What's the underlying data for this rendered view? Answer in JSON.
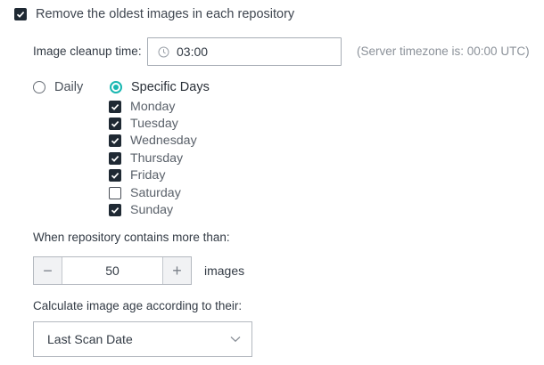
{
  "remove_oldest": {
    "label": "Remove the oldest images in each repository",
    "checked": true
  },
  "cleanup_time": {
    "label": "Image cleanup time:",
    "value": "03:00",
    "timezone_note": "(Server timezone is: 00:00 UTC)"
  },
  "schedule": {
    "options": [
      {
        "label": "Daily",
        "selected": false
      },
      {
        "label": "Specific Days",
        "selected": true
      }
    ],
    "days": [
      {
        "label": "Monday",
        "checked": true
      },
      {
        "label": "Tuesday",
        "checked": true
      },
      {
        "label": "Wednesday",
        "checked": true
      },
      {
        "label": "Thursday",
        "checked": true
      },
      {
        "label": "Friday",
        "checked": true
      },
      {
        "label": "Saturday",
        "checked": false
      },
      {
        "label": "Sunday",
        "checked": true
      }
    ]
  },
  "repo_count": {
    "label": "When repository contains more than:",
    "decrement": "−",
    "value": "50",
    "increment": "+",
    "suffix": "images"
  },
  "age": {
    "label": "Calculate image age according to their:",
    "selected": "Last Scan Date"
  },
  "icons": {
    "checkbox_check": "check-icon",
    "time": "clock-icon",
    "dropdown": "chevron-down-icon"
  },
  "colors": {
    "checkbox_fill": "#1f2933",
    "radio_accent": "#19b7b1",
    "muted_text": "#8b9199"
  }
}
